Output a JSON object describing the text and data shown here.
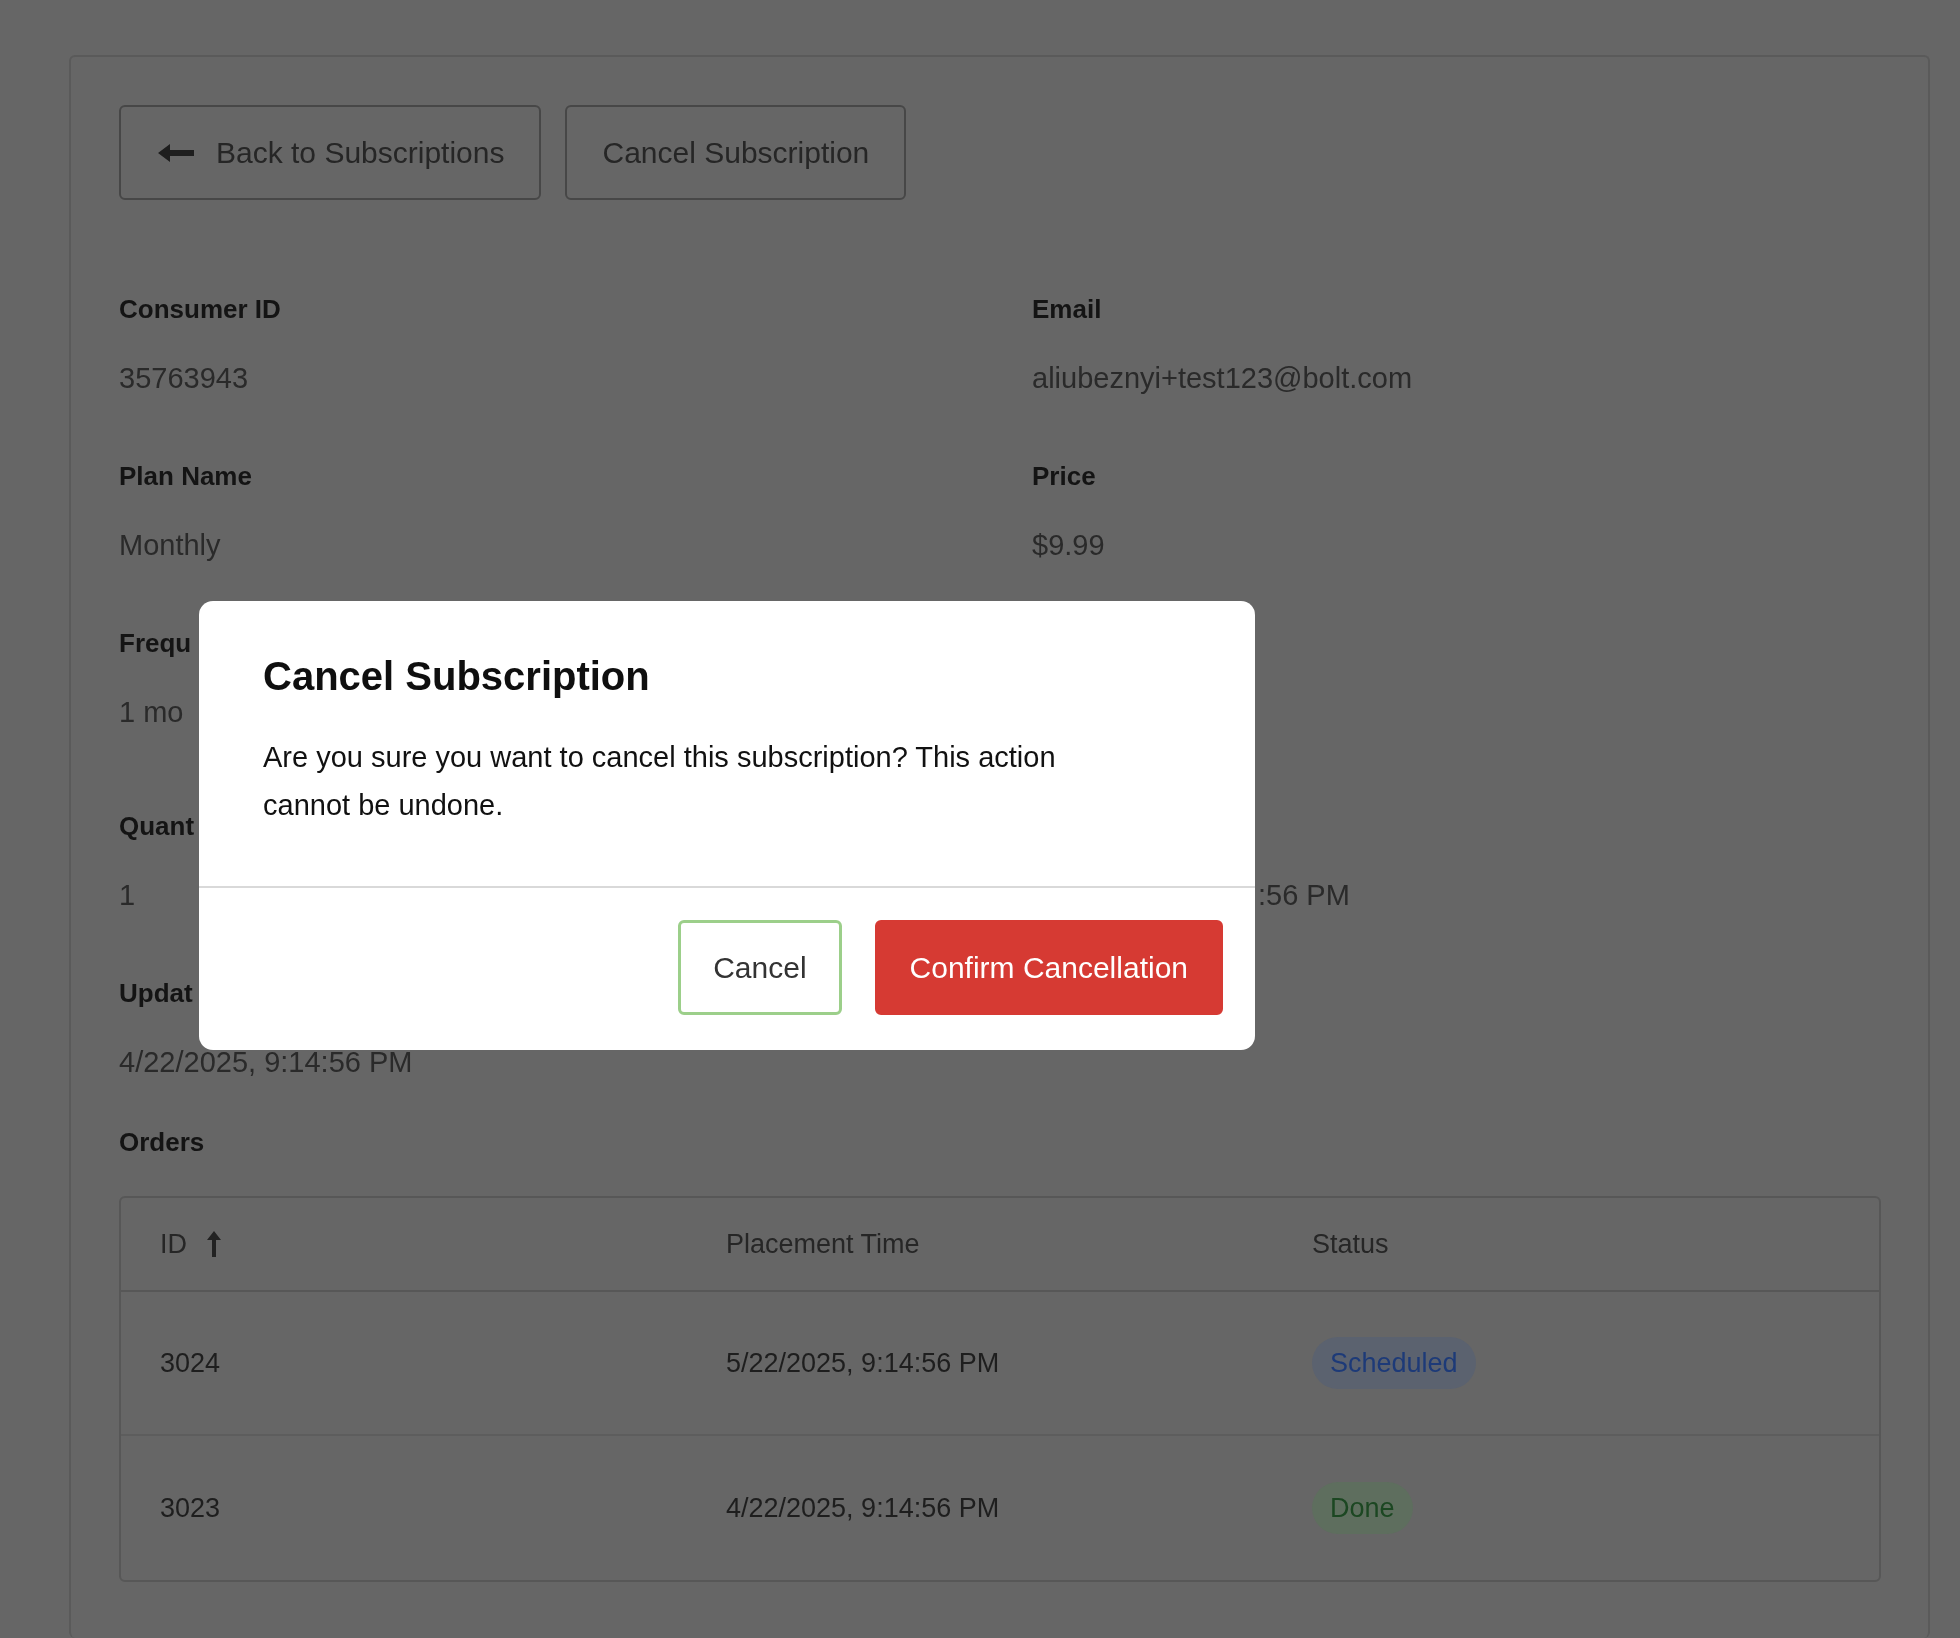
{
  "toolbar": {
    "buttons": [
      {
        "label": "Back to Subscriptions",
        "kind": "back"
      },
      {
        "label": "Cancel Subscription",
        "kind": "plain"
      }
    ]
  },
  "details": [
    {
      "left": {
        "label": "Consumer ID",
        "value": "35763943"
      },
      "right": {
        "label": "Email",
        "value": "aliubeznyi+test123@bolt.com"
      }
    },
    {
      "left": {
        "label": "Plan Name",
        "value": "Monthly"
      },
      "right": {
        "label": "Price",
        "value": "$9.99"
      }
    },
    {
      "left": {
        "label": "Frequ",
        "value": "1 mo"
      }
    },
    {
      "left": {
        "label": "Quant",
        "value": "1"
      },
      "right": {
        "value": ":56 PM"
      }
    },
    {
      "left": {
        "label": "Updat",
        "value": "4/22/2025, 9:14:56 PM"
      }
    }
  ],
  "orders": {
    "title": "Orders",
    "columns": [
      {
        "label": "ID",
        "sorted": true
      },
      {
        "label": "Placement Time",
        "sorted": false
      },
      {
        "label": "Status",
        "sorted": false
      }
    ],
    "rows": [
      {
        "id": "3024",
        "placement_time": "5/22/2025, 9:14:56 PM",
        "status": {
          "text": "Scheduled",
          "kind": "scheduled"
        }
      },
      {
        "id": "3023",
        "placement_time": "4/22/2025, 9:14:56 PM",
        "status": {
          "text": "Done",
          "kind": "done"
        }
      }
    ]
  },
  "dialog": {
    "title": "Cancel Subscription",
    "message": "Are you sure you want to cancel this subscription? This action cannot be undone.",
    "buttons": [
      {
        "label": "Cancel",
        "kind": "secondary",
        "focused": true
      },
      {
        "label": "Confirm Cancellation",
        "kind": "danger",
        "focused": false
      }
    ]
  }
}
